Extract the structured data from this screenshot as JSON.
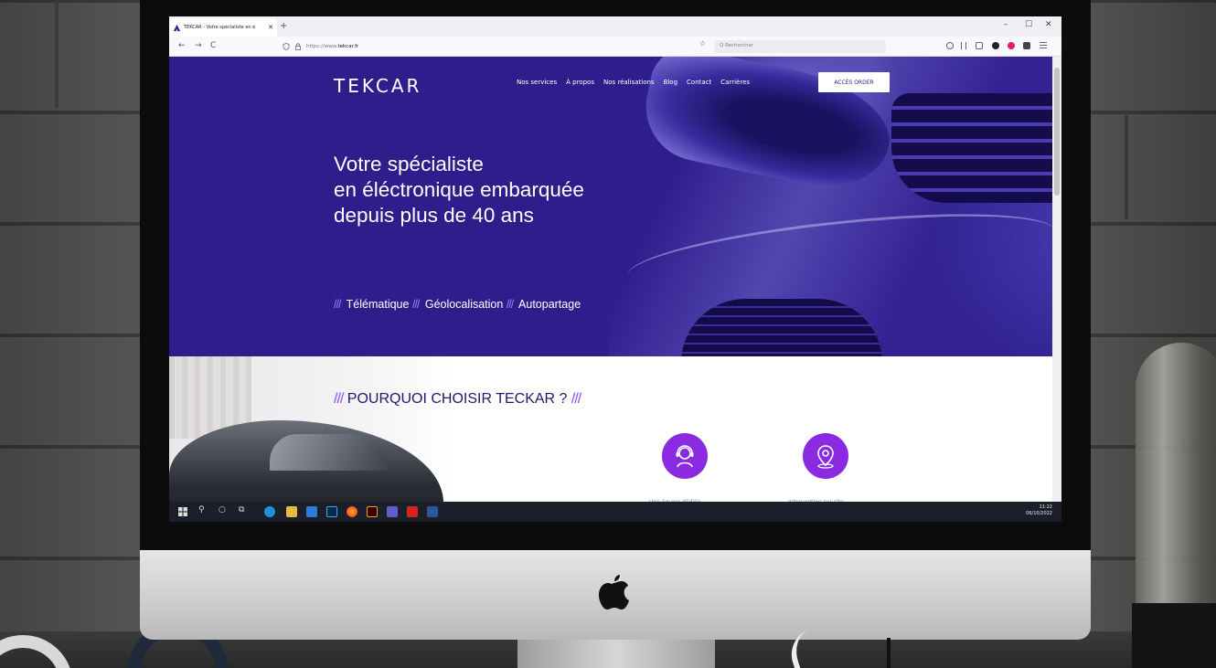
{
  "browser": {
    "tab_title": "TEKCAR - Votre spécialiste en é",
    "tab_close": "✕",
    "new_tab": "+",
    "url_prefix": "https://www.",
    "url_domain": "tekcar.fr",
    "search_placeholder": "Q Rechercher",
    "window_controls": [
      "–",
      "☐",
      "✕"
    ],
    "nav_glyphs": [
      "←",
      "→",
      "C"
    ],
    "lock_glyph": "🔒",
    "star_glyph": "☆"
  },
  "site": {
    "brand": "TEKCAR",
    "nav": [
      "Nos services",
      "À propos",
      "Nos réalisations",
      "Blog",
      "Contact",
      "Carrières"
    ],
    "order_button": "ACCÈS ORDER",
    "hero_title": [
      "Votre spécialiste",
      "en éléctronique embarquée",
      "depuis plus de 40 ans"
    ],
    "tagline_slash": "///",
    "tagline": [
      "Télématique",
      "Géolocalisation",
      "Autopartage"
    ],
    "section_title": "POURQUOI CHOISIR TECKAR ?",
    "section_slash": "///",
    "features": [
      {
        "icon": "headset-agent-icon",
        "label": "Une équipe dédiée"
      },
      {
        "icon": "location-pin-icon",
        "label": "Intervention sur site"
      }
    ],
    "accent_color": "#2e1e8c",
    "feature_color": "#8a2be2"
  },
  "taskbar": {
    "time": "11:22",
    "date": "06/10/2022",
    "icons": [
      "windows-start-icon",
      "search-icon",
      "cortana-icon",
      "task-view-icon",
      "edge-icon",
      "file-explorer-icon",
      "outlook-icon",
      "photoshop-icon",
      "firefox-icon",
      "illustrator-icon",
      "teams-icon",
      "acrobat-icon",
      "word-icon"
    ]
  }
}
